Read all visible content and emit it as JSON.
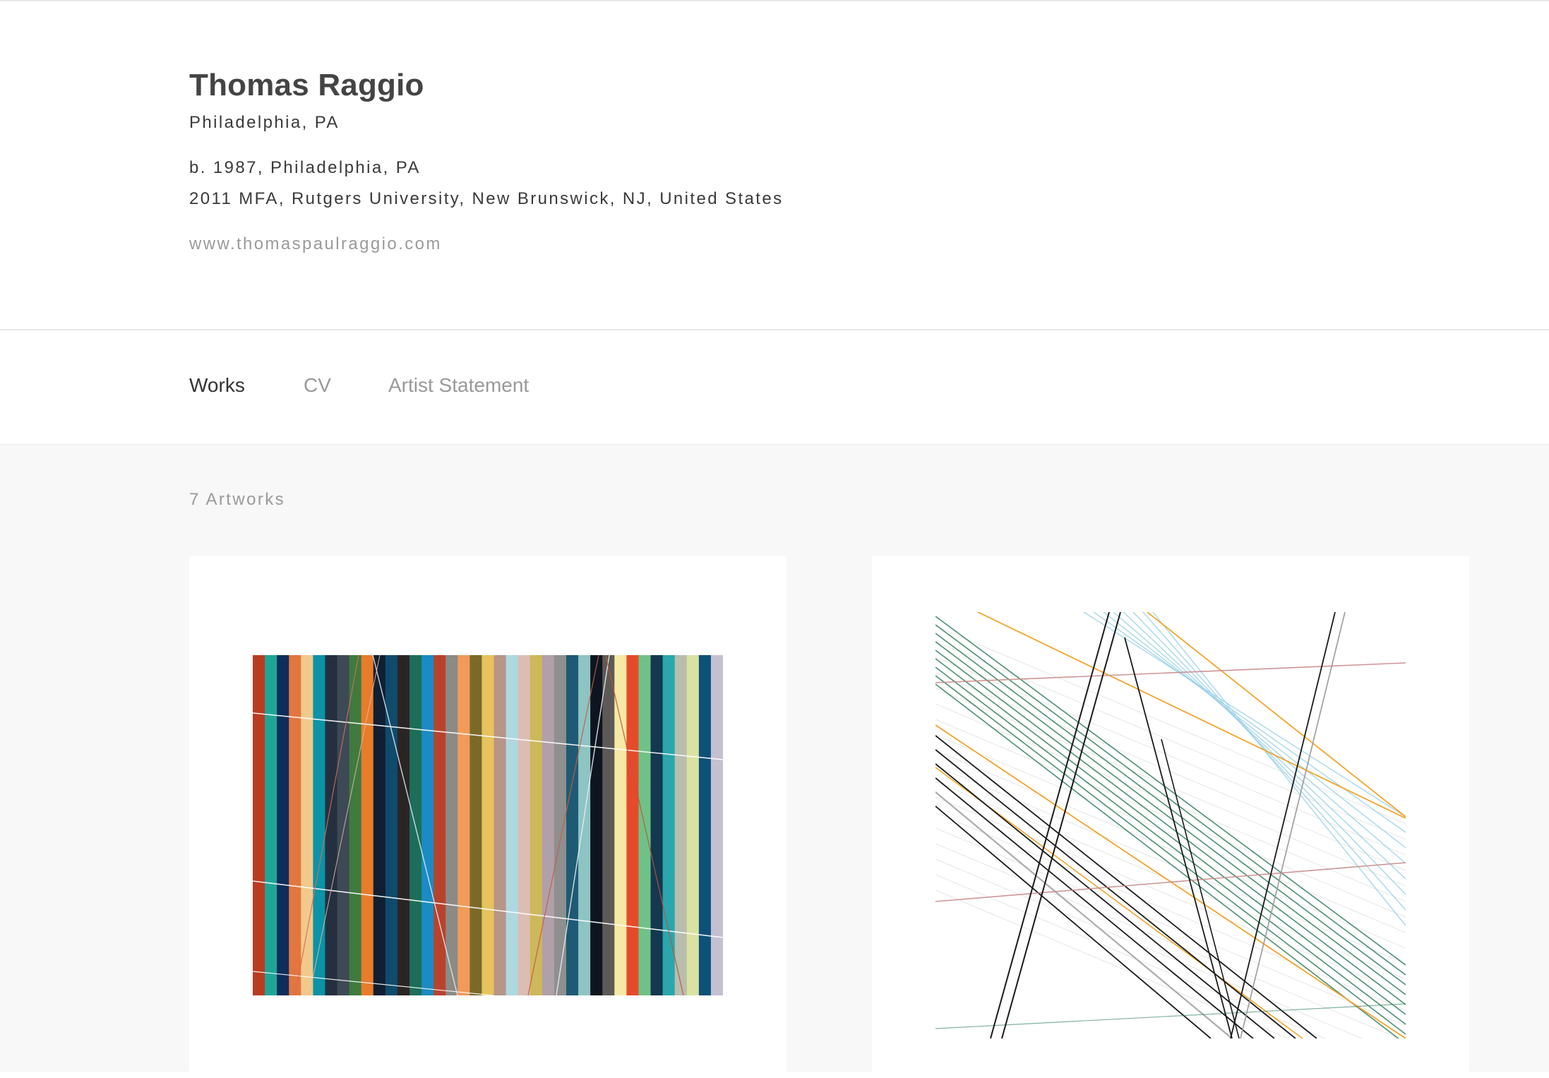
{
  "artist": {
    "name": "Thomas Raggio",
    "location": "Philadelphia, PA",
    "born": "b. 1987, Philadelphia, PA",
    "education": "2011 MFA, Rutgers University, New Brunswick, NJ, United States",
    "website": "www.thomaspaulraggio.com"
  },
  "tabs": {
    "works": "Works",
    "cv": "CV",
    "statement": "Artist Statement",
    "active": "Works"
  },
  "gallery": {
    "count_label": "7 Artworks"
  },
  "artwork_1": {
    "stripe_colors": [
      "#b93c22",
      "#1fa597",
      "#0e2d5a",
      "#e2763e",
      "#f2c98b",
      "#0b93a6",
      "#24303f",
      "#3d4955",
      "#3f7a3e",
      "#e97c2a",
      "#101f31",
      "#0f4b6b",
      "#2a2524",
      "#1c6e58",
      "#1a8bc4",
      "#b8432c",
      "#8b8b86",
      "#f29a59",
      "#7a6a28",
      "#e6c35c",
      "#b79587",
      "#aed8df",
      "#dcbdb4",
      "#cdb85a",
      "#b0a0a9",
      "#8f8f8f",
      "#1f5a74",
      "#8ec4c2",
      "#0e1520",
      "#5b5a57",
      "#f6e9a4",
      "#e54b2b",
      "#6fc287",
      "#13384f",
      "#2aa6ad",
      "#b9bdad",
      "#d9e2a1",
      "#0d5178",
      "#c5bfd2"
    ],
    "line_color": "#ffffff"
  },
  "artwork_2": {
    "palette": {
      "black": "#1a1a1a",
      "gray": "#c7c7c7",
      "green": "#2e7d5a",
      "orange": "#f3a427",
      "blue": "#9fd3e8",
      "red": "#c98a8a"
    }
  }
}
